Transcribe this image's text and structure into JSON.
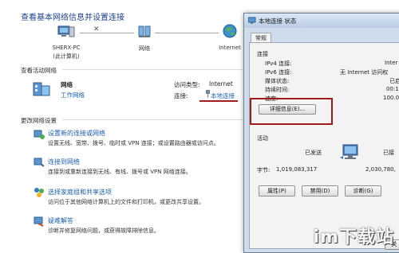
{
  "page": {
    "title": "查看基本网络信息并设置连接",
    "topology": {
      "computer_name": "SHERX-PC",
      "computer_sub": "(此计算机)",
      "network_label": "网络",
      "internet_label": "Internet"
    },
    "active_networks": {
      "title": "查看活动网络",
      "network_name": "网络",
      "network_type": "工作网络",
      "access_type_label": "访问类型:",
      "access_type_value": "Internet",
      "connection_label": "连接:",
      "connection_value": "本地连接"
    },
    "change_settings": {
      "title": "更改网络设置",
      "items": [
        {
          "link": "设置新的连接或网络",
          "desc": "设置无线、宽带、拨号、临时或 VPN 连接；或设置路由器或访问点。",
          "icon": "new-connection-icon"
        },
        {
          "link": "连接到网络",
          "desc": "连接到或重新连接到无线、有线、拨号或 VPN 网络连接。",
          "icon": "connect-network-icon"
        },
        {
          "link": "选择家庭组和共享选项",
          "desc": "访问位于其他网络计算机上的文件和打印机，或更改共享设置。",
          "icon": "homegroup-icon"
        },
        {
          "link": "疑难解答",
          "desc": "诊断并修复网络问题，或获得故障排除信息。",
          "icon": "troubleshoot-icon"
        }
      ]
    }
  },
  "dialog": {
    "title": "本地连接 状态",
    "tab": "常规",
    "connection_section": "连接",
    "rows": [
      {
        "label": "IPv4 连接:",
        "value": "Inter"
      },
      {
        "label": "IPv6 连接:",
        "value": "无 Internet 访问权"
      },
      {
        "label": "媒体状态:",
        "value": "已启"
      },
      {
        "label": "持续时间:",
        "value": "00:1"
      },
      {
        "label": "速度:",
        "value": "100.0"
      }
    ],
    "details_button": "详细信息(E)...",
    "activity_section": "活动",
    "sent_label": "已发送",
    "received_label": "已接",
    "bytes_label": "字节:",
    "bytes_sent": "1,019,083,317",
    "bytes_received": "2,030,780,",
    "properties_button": "属性(P)",
    "disable_button": "禁用(D)",
    "diagnose_button": "诊断(G)",
    "close_button": "关"
  },
  "watermark": "im下载站",
  "colors": {
    "link": "#1c5fb0",
    "title": "#1b3f8b",
    "highlight_box": "#a01b1b"
  }
}
